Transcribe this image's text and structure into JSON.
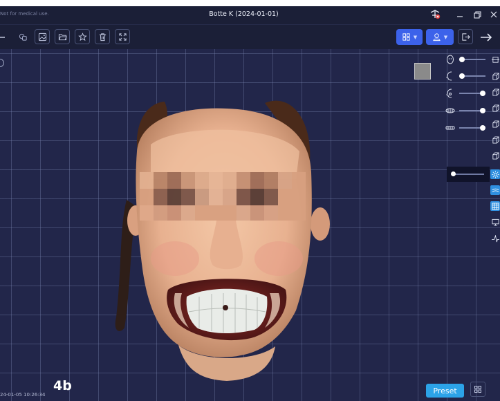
{
  "window": {
    "disclaimer": "Not for medical use.",
    "title": "Botte K (2024-01-01)"
  },
  "toolbar": {
    "left_icons": [
      "back-icon",
      "layers-icon",
      "image-icon",
      "folder-open-icon",
      "star-icon",
      "trash-icon",
      "expand-icon"
    ],
    "right_icons": [
      "grid-view-icon",
      "user-profile-icon",
      "export-icon",
      "next-arrow-icon"
    ]
  },
  "viewport": {
    "figure_label": "4b",
    "timestamp": "24-01-05 10:26:34",
    "preset_label": "Preset",
    "swatch_color": "#8a8a8a",
    "opacity_sliders": [
      {
        "icon": "face-front-icon",
        "value": 0.0
      },
      {
        "icon": "face-side-icon",
        "value": 0.0
      },
      {
        "icon": "face-profile-icon",
        "value": 1.0
      },
      {
        "icon": "upper-jaw-icon",
        "value": 1.0
      },
      {
        "icon": "lower-jaw-icon",
        "value": 1.0
      }
    ],
    "brightness_value": 0.0,
    "right_rail": [
      "view-front-icon",
      "view-top-icon",
      "view-left-icon",
      "view-right-icon",
      "view-back-icon",
      "view-bottom-icon",
      "view-iso-icon",
      "light-icon",
      "layers-toggle-icon",
      "grid-toggle-icon",
      "monitor-icon",
      "pointer-icon"
    ]
  },
  "colors": {
    "background": "#22264a",
    "toolbar": "#1b1f37",
    "accent_blue": "#3c62ea",
    "preset_blue": "#2ca3e8"
  }
}
